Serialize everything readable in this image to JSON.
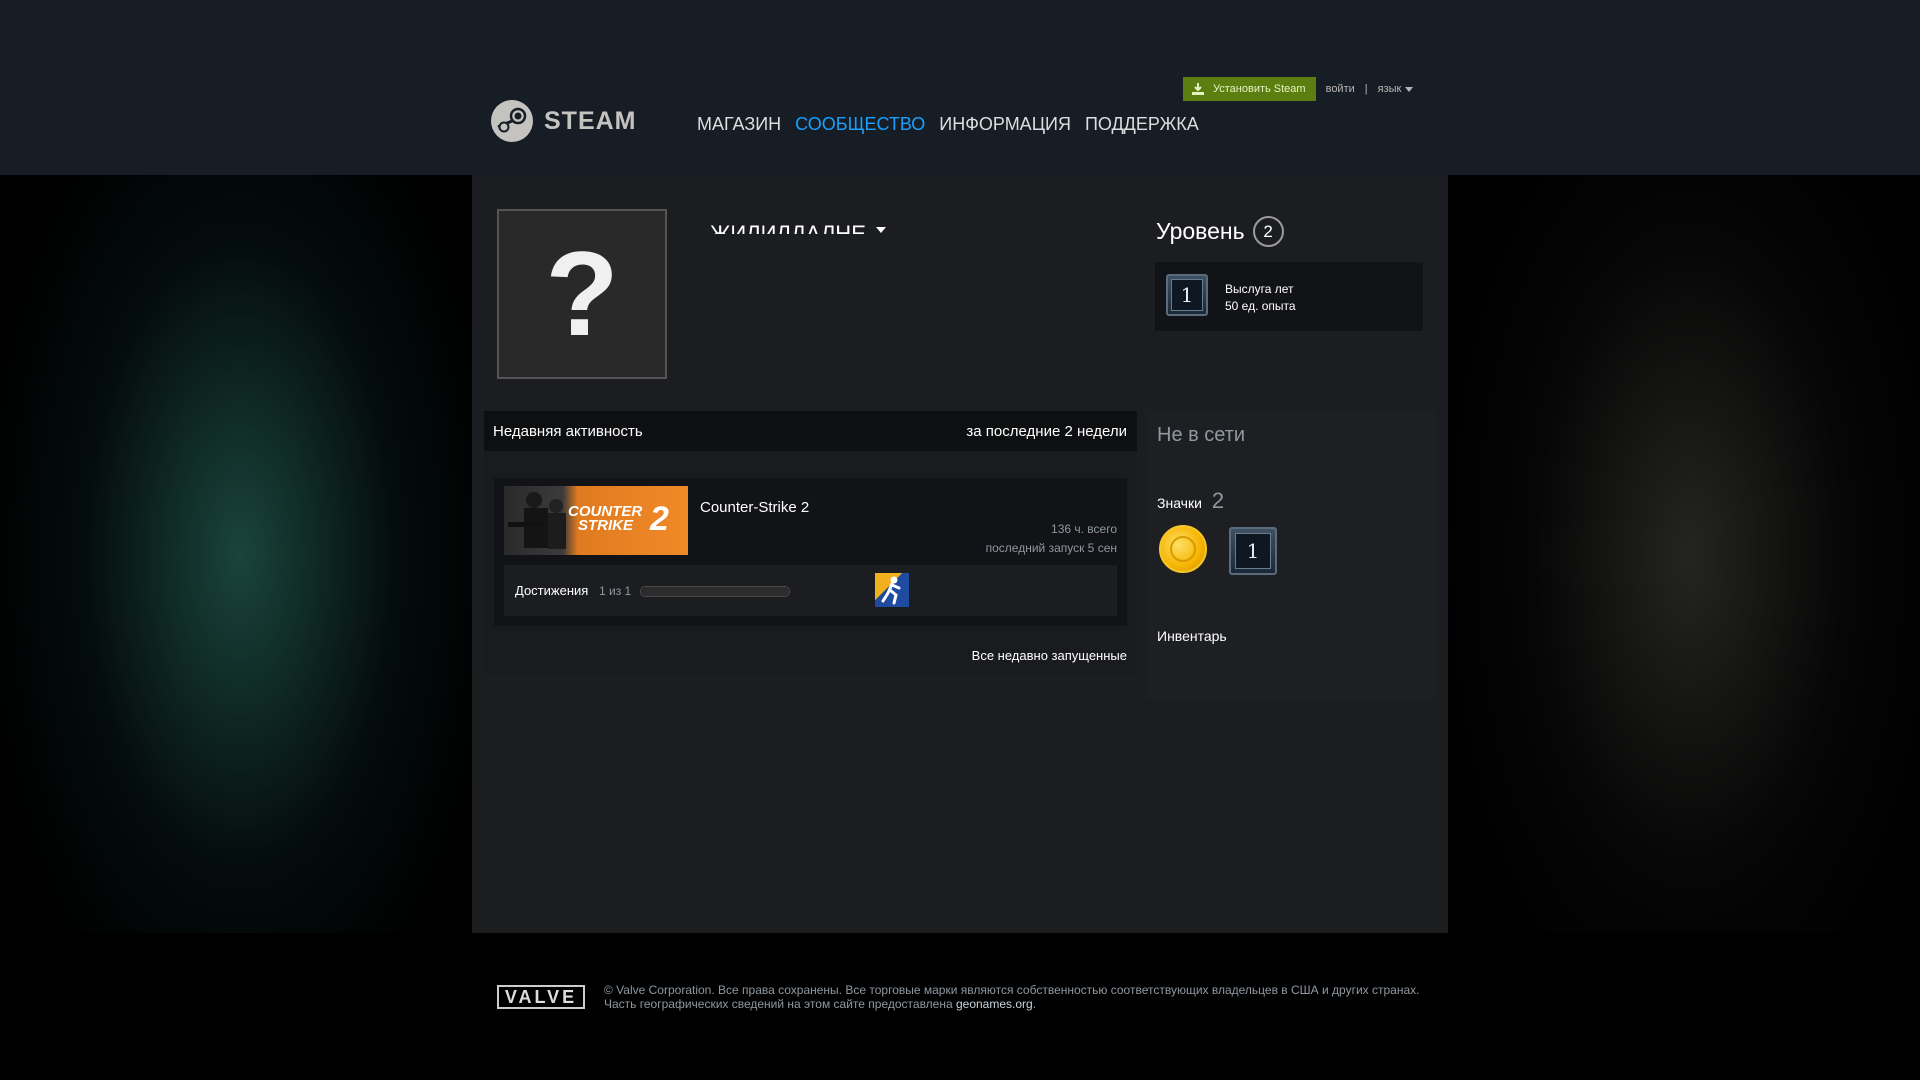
{
  "header": {
    "logo_text": "STEAM",
    "nav": [
      {
        "label": "МАГАЗИН"
      },
      {
        "label": "СООБЩЕСТВО"
      },
      {
        "label": "ИНФОРМАЦИЯ"
      },
      {
        "label": "ПОДДЕРЖКА"
      }
    ],
    "install_label": "Установить Steam",
    "login_label": "войти",
    "separator": "|",
    "language_label": "язык"
  },
  "profile": {
    "avatar_glyph": "?",
    "persona_name": "ЖИЛИЛДАЛНЕ"
  },
  "level": {
    "label": "Уровень",
    "value": "2",
    "badge": {
      "number": "1",
      "name": "Выслуга лет",
      "xp": "50 ед. опыта"
    }
  },
  "activity": {
    "title": "Недавняя активность",
    "period": "за последние 2 недели",
    "game": {
      "capsule_line1": "COUNTER",
      "capsule_line2": "STRIKE",
      "capsule_number": "2",
      "name": "Counter-Strike 2",
      "hours": "136 ч. всего",
      "last_played": "последний запуск 5 сен",
      "achievements_label": "Достижения",
      "achievements_count": "1 из 1",
      "achievements_progress": 1.0
    },
    "all_recent_label": "Все недавно запущенные"
  },
  "sidebar": {
    "status": "Не в сети",
    "badges_label": "Значки",
    "badges_count": "2",
    "years_badge_number": "1",
    "inventory_label": "Инвентарь"
  },
  "footer": {
    "valve_logo": "VALVE",
    "line1": "© Valve Corporation. Все права сохранены. Все торговые марки являются собственностью соответствующих владельцев в США и других странах.",
    "line2_prefix": "Часть географических сведений на этом сайте предоставлена ",
    "line2_link": "geonames.org",
    "line2_suffix": "."
  },
  "colors": {
    "header_bg": "#171d25",
    "nav_active": "#1a9fff",
    "install_green": "#5c7e10"
  }
}
